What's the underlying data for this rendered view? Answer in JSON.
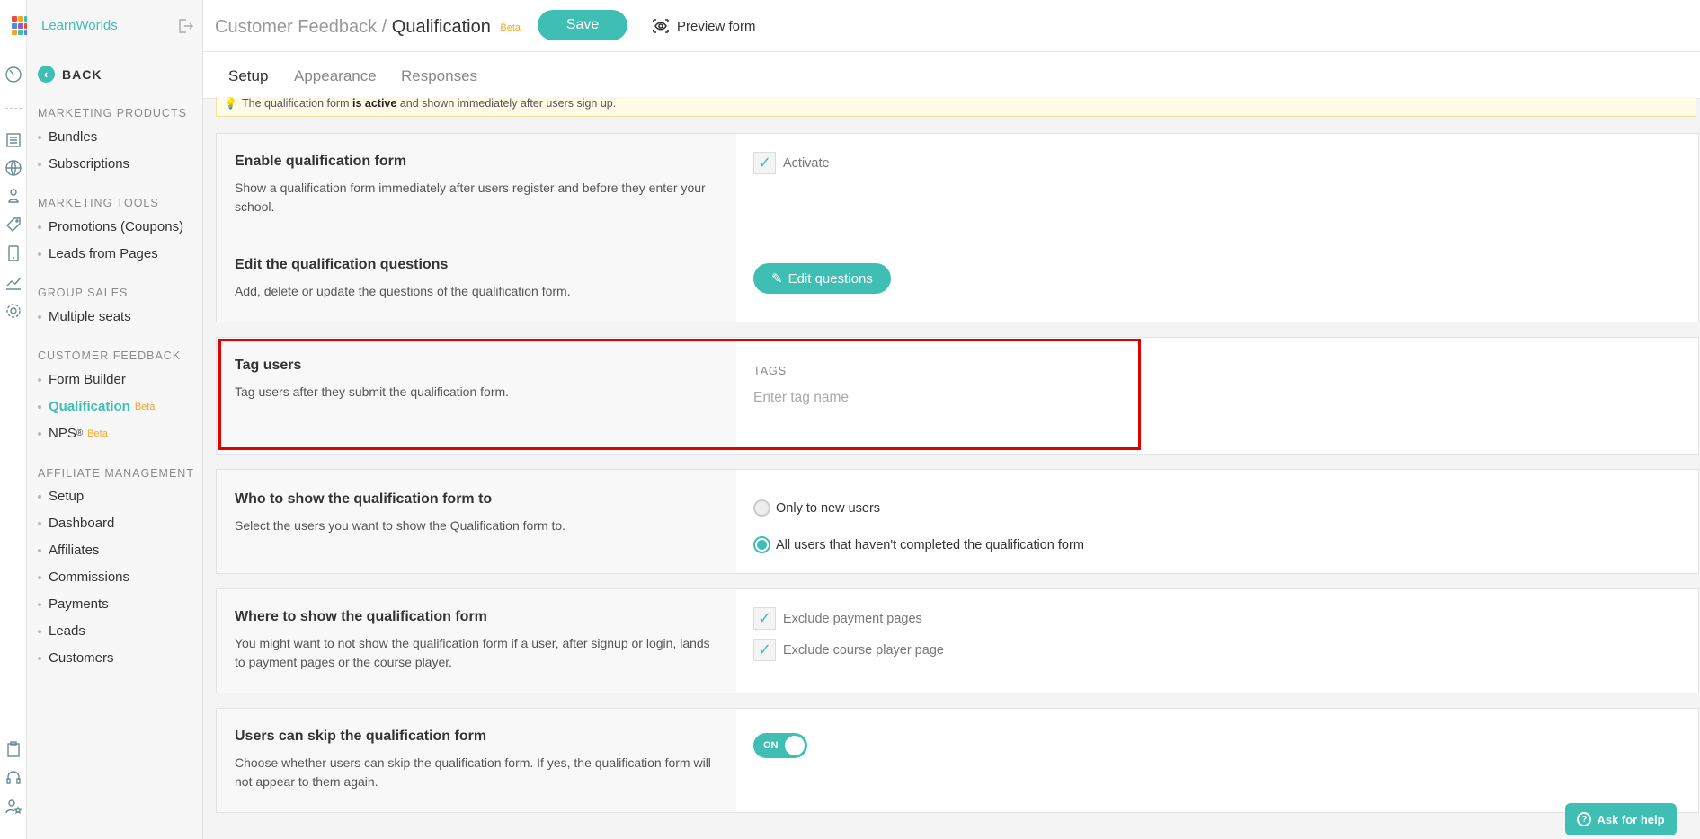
{
  "brand": {
    "name": "LearnWorlds",
    "logo_colors": [
      "#e94e3c",
      "#f5a623",
      "#3fbfb4",
      "#4a90d9",
      "#9b59b6",
      "#e94e3c",
      "#f5a623",
      "#3fbfb4",
      "#4a90d9"
    ]
  },
  "sidebar": {
    "back_label": "BACK",
    "sections": [
      {
        "title": "MARKETING PRODUCTS",
        "items": [
          {
            "label": "Bundles"
          },
          {
            "label": "Subscriptions"
          }
        ]
      },
      {
        "title": "MARKETING TOOLS",
        "items": [
          {
            "label": "Promotions (Coupons)"
          },
          {
            "label": "Leads from Pages"
          }
        ]
      },
      {
        "title": "GROUP SALES",
        "items": [
          {
            "label": "Multiple seats"
          }
        ]
      },
      {
        "title": "CUSTOMER FEEDBACK",
        "items": [
          {
            "label": "Form Builder"
          },
          {
            "label": "Qualification",
            "badge": "Beta",
            "active": true
          },
          {
            "label": "NPS",
            "sup": "®",
            "badge": "Beta"
          }
        ]
      },
      {
        "title": "AFFILIATE MANAGEMENT",
        "items": [
          {
            "label": "Setup"
          },
          {
            "label": "Dashboard"
          },
          {
            "label": "Affiliates"
          },
          {
            "label": "Commissions"
          },
          {
            "label": "Payments"
          },
          {
            "label": "Leads"
          },
          {
            "label": "Customers"
          }
        ]
      }
    ]
  },
  "header": {
    "crumb_parent": "Customer Feedback",
    "crumb_sep": "/",
    "crumb_current": "Qualification",
    "beta": "Beta",
    "save_label": "Save",
    "preview_label": "Preview form"
  },
  "tabs": [
    {
      "label": "Setup",
      "active": true
    },
    {
      "label": "Appearance"
    },
    {
      "label": "Responses"
    }
  ],
  "notice": {
    "pre": "The qualification form",
    "bold": "is active",
    "post": "and shown immediately after users sign up."
  },
  "cards": {
    "enable": {
      "title": "Enable qualification form",
      "desc": "Show a qualification form immediately after users register and before they enter your school.",
      "checkbox_label": "Activate",
      "checked": true
    },
    "edit": {
      "title": "Edit the qualification questions",
      "desc": "Add, delete or update the questions of the qualification form.",
      "button_label": "Edit questions"
    },
    "tags": {
      "title": "Tag users",
      "desc": "Tag users after they submit the qualification form.",
      "field_label": "TAGS",
      "placeholder": "Enter tag name",
      "value": ""
    },
    "who": {
      "title": "Who to show the qualification form to",
      "desc": "Select the users you want to show the Qualification form to.",
      "options": [
        {
          "label": "Only to new users",
          "selected": false
        },
        {
          "label": "All users that haven't completed the qualification form",
          "selected": true
        }
      ]
    },
    "where": {
      "title": "Where to show the qualification form",
      "desc": "You might want to not show the qualification form if a user, after signup or login, lands to payment pages or the course player.",
      "options": [
        {
          "label": "Exclude payment pages",
          "checked": true
        },
        {
          "label": "Exclude course player page",
          "checked": true
        }
      ]
    },
    "skip": {
      "title": "Users can skip the qualification form",
      "desc": "Choose whether users can skip the qualification form. If yes, the qualification form will not appear to them again.",
      "toggle_label": "ON",
      "on": true
    }
  },
  "help": {
    "label": "Ask for help"
  },
  "colors": {
    "accent": "#3fbfb4",
    "beta": "#f5a623",
    "highlight": "#e00000"
  }
}
